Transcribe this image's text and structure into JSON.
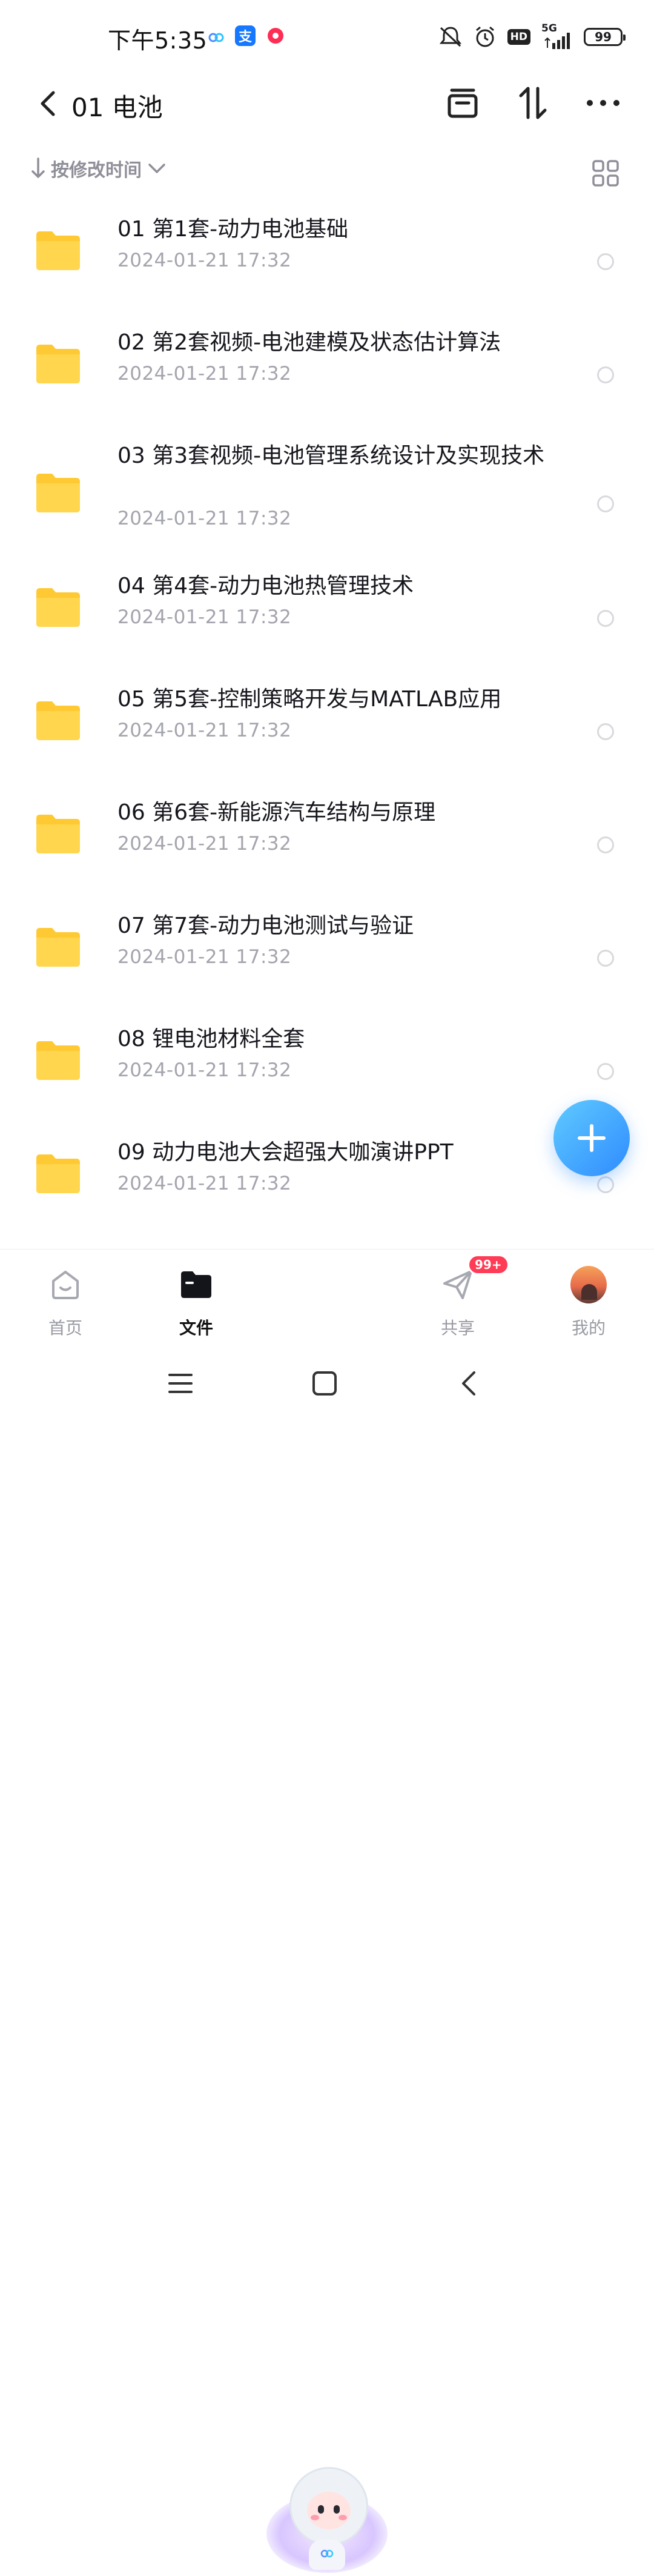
{
  "status_bar": {
    "time": "下午5:35",
    "network": "5G",
    "hd": "HD",
    "battery": "99"
  },
  "header": {
    "title": "01 电池"
  },
  "sort": {
    "label": "按修改时间"
  },
  "files": [
    {
      "name": "01 第1套-动力电池基础",
      "date": "2024-01-21  17:32"
    },
    {
      "name": "02 第2套视频-电池建模及状态估计算法",
      "date": "2024-01-21  17:32"
    },
    {
      "name": "03 第3套视频-电池管理系统设计及实现技术",
      "date": "2024-01-21  17:32"
    },
    {
      "name": "04 第4套-动力电池热管理技术",
      "date": "2024-01-21  17:32"
    },
    {
      "name": "05 第5套-控制策略开发与MATLAB应用",
      "date": "2024-01-21  17:32"
    },
    {
      "name": "06 第6套-新能源汽车结构与原理",
      "date": "2024-01-21  17:32"
    },
    {
      "name": "07 第7套-动力电池测试与验证",
      "date": "2024-01-21  17:32"
    },
    {
      "name": "08  锂电池材料全套",
      "date": "2024-01-21  17:32"
    },
    {
      "name": "09  动力电池大会超强大咖演讲PPT",
      "date": "2024-01-21  17:32"
    }
  ],
  "bottom_nav": {
    "home": "首页",
    "files": "文件",
    "share": "共享",
    "share_badge": "99+",
    "mine": "我的"
  },
  "colors": {
    "accent": "#2f8bff",
    "folder": "#ffc933",
    "badge": "#ff3b56"
  },
  "icons": [
    "back-icon",
    "archive-icon",
    "sort-icon",
    "more-icon",
    "down-arrow-icon",
    "grid-view-icon",
    "folder-icon",
    "plus-icon",
    "home-icon",
    "files-icon",
    "share-icon",
    "menu-icon",
    "square-icon"
  ]
}
